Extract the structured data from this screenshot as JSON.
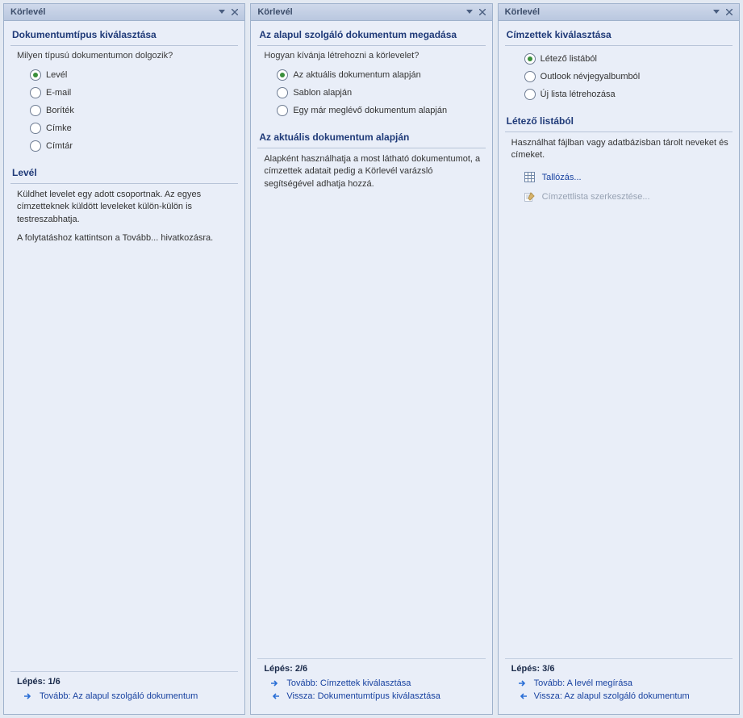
{
  "panes": [
    {
      "title": "Körlevél",
      "heading1": "Dokumentumtípus kiválasztása",
      "prompt1": "Milyen típusú dokumentumon dolgozik?",
      "radios1": [
        {
          "label": "Levél",
          "selected": true
        },
        {
          "label": "E-mail",
          "selected": false
        },
        {
          "label": "Boríték",
          "selected": false
        },
        {
          "label": "Címke",
          "selected": false
        },
        {
          "label": "Címtár",
          "selected": false
        }
      ],
      "heading2": "Levél",
      "body_lines": [
        "Küldhet levelet egy adott csoportnak. Az egyes címzetteknek küldött leveleket külön-külön is testreszabhatja.",
        "A folytatáshoz kattintson a Tovább... hivatkozásra."
      ],
      "step": "Lépés: 1/6",
      "next": "Tovább: Az alapul szolgáló dokumentum"
    },
    {
      "title": "Körlevél",
      "heading1": "Az alapul szolgáló dokumentum megadása",
      "prompt1": "Hogyan kívánja létrehozni a körlevelet?",
      "radios1": [
        {
          "label": "Az aktuális dokumentum alapján",
          "selected": true
        },
        {
          "label": "Sablon alapján",
          "selected": false
        },
        {
          "label": "Egy már meglévő dokumentum alapján",
          "selected": false
        }
      ],
      "heading2": "Az aktuális dokumentum alapján",
      "body_lines": [
        "Alapként használhatja a most látható dokumentumot, a címzettek adatait pedig a Körlevél varázsló segítségével adhatja hozzá."
      ],
      "step": "Lépés: 2/6",
      "next": "Tovább: Címzettek kiválasztása",
      "back": "Vissza: Dokumentumtípus kiválasztása"
    },
    {
      "title": "Körlevél",
      "heading1": "Címzettek kiválasztása",
      "radios1": [
        {
          "label": "Létező listából",
          "selected": true
        },
        {
          "label": "Outlook névjegyalbumból",
          "selected": false
        },
        {
          "label": "Új lista létrehozása",
          "selected": false
        }
      ],
      "heading2": "Létező listából",
      "body_lines": [
        "Használhat fájlban vagy adatbázisban tárolt neveket és címeket."
      ],
      "links": {
        "browse": "Tallózás...",
        "edit": "Címzettlista szerkesztése..."
      },
      "step": "Lépés: 3/6",
      "next": "Tovább: A levél megírása",
      "back": "Vissza: Az alapul szolgáló dokumentum"
    }
  ]
}
